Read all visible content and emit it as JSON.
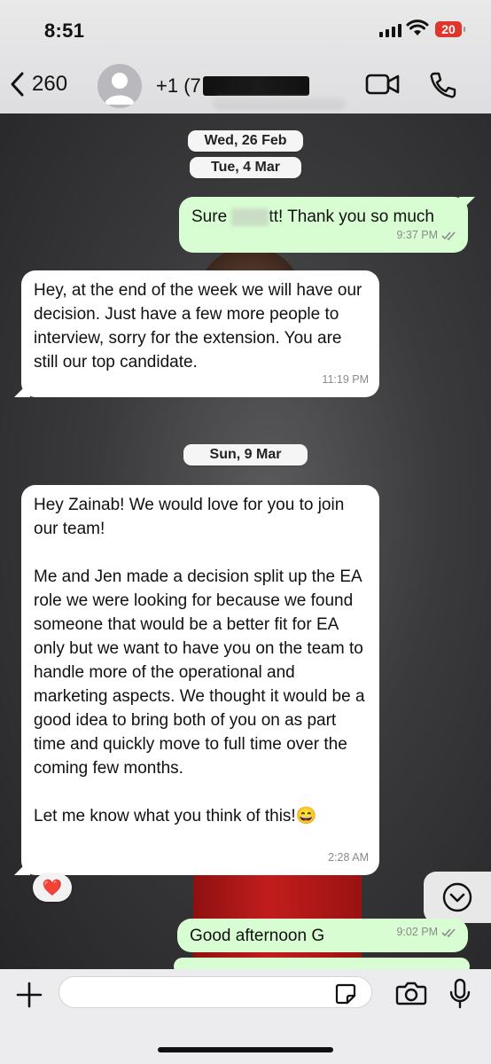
{
  "status_bar": {
    "time": "8:51",
    "battery": "20",
    "battery_color": "#e0352b"
  },
  "header": {
    "back_count": "260",
    "contact_prefix": "+1 (7",
    "icons": [
      "chevron-left-icon",
      "avatar-placeholder-icon",
      "video-call-icon",
      "phone-icon"
    ]
  },
  "dates": {
    "d1": "Wed, 26 Feb",
    "d2": "Tue, 4 Mar",
    "d3": "Sun, 9 Mar"
  },
  "messages": [
    {
      "dir": "out",
      "text_a": "Sure ",
      "text_b": "tt! Thank you so much",
      "time": "9:37 PM",
      "ticks": "read"
    },
    {
      "dir": "in",
      "text": "Hey, at the end of the week we will have our decision. Just have a few more people to interview, sorry for the extension. You are still our top candidate.",
      "time": "11:19 PM"
    },
    {
      "dir": "in",
      "text": "Hey Zainab! We would love for you to join our team!\n\nMe and Jen made a decision split up the EA role we were looking for because we found someone that would be a better fit for EA only but we want to have you on the team to handle more of the operational and marketing aspects. We thought it would be a good idea to bring both of you on as part time and quickly move to full time over the coming few months.\n\nLet me know what you think of this!",
      "emoji": "😄",
      "time": "2:28 AM",
      "reaction": "❤️"
    },
    {
      "dir": "out",
      "text": "Good afternoon G",
      "time": "9:02 PM",
      "ticks": "read"
    }
  ],
  "composer": {
    "placeholder": ""
  },
  "colors": {
    "outgoing_bubble": "#d9fdd3",
    "incoming_bubble": "#ffffff",
    "header_bg": "#e9e9ea"
  }
}
